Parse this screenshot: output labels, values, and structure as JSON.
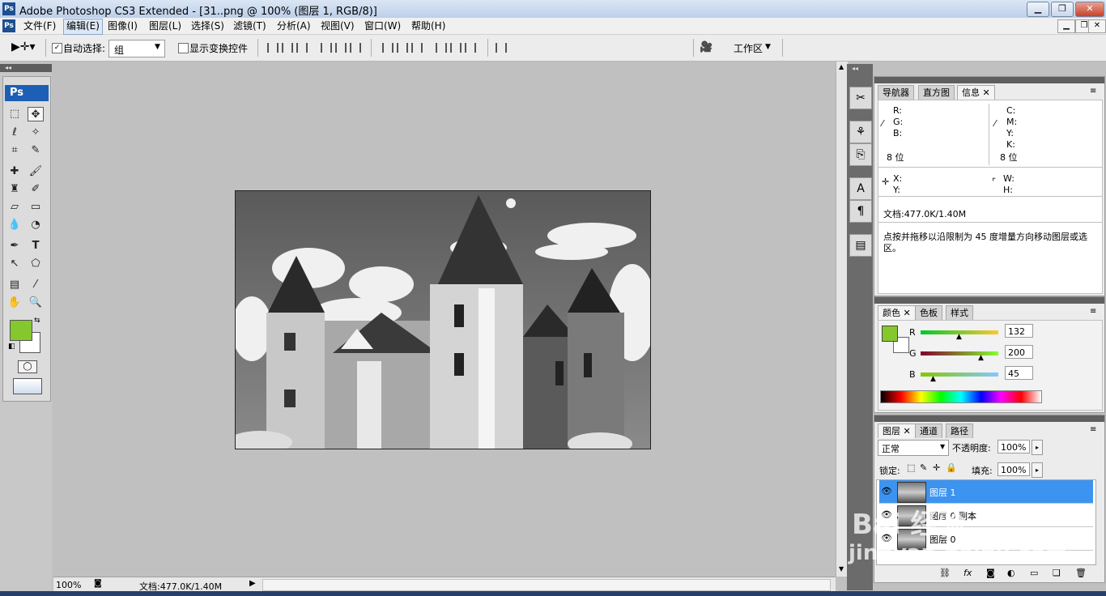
{
  "window": {
    "title": "Adobe Photoshop CS3 Extended - [31..png @ 100% (图层 1, RGB/8)]",
    "app_icon": "Ps",
    "controls": [
      "minimize-icon",
      "restore-icon",
      "close-icon"
    ]
  },
  "menu": {
    "items": [
      "文件(F)",
      "编辑(E)",
      "图像(I)",
      "图层(L)",
      "选择(S)",
      "滤镜(T)",
      "分析(A)",
      "视图(V)",
      "窗口(W)",
      "帮助(H)"
    ],
    "active": "编辑(E)",
    "doc_controls": [
      "minimize-icon",
      "restore-icon",
      "close-icon"
    ]
  },
  "options": {
    "auto_select_label": "自动选择:",
    "auto_select_checked": true,
    "auto_select_value": "组",
    "show_transform_label": "显示变换控件",
    "show_transform_checked": false,
    "workspace_label": "工作区"
  },
  "tools": {
    "logo": "Ps",
    "foreground_color": "#84c82d",
    "background_color": "#ffffff",
    "selected_tool": "move-tool"
  },
  "document": {
    "zoom": "100%",
    "doc_info": "文档:477.0K/1.40M"
  },
  "info_panel": {
    "tabs": [
      "导航器",
      "直方图",
      "信息"
    ],
    "active_tab": "信息",
    "left_channels": [
      "R:",
      "G:",
      "B:"
    ],
    "right_channels": [
      "C:",
      "M:",
      "Y:",
      "K:"
    ],
    "left_bits": "8 位",
    "right_bits": "8 位",
    "xy": [
      "X:",
      "Y:"
    ],
    "wh": [
      "W:",
      "H:"
    ],
    "doc_info": "文档:477.0K/1.40M",
    "hint": "点按并拖移以沿限制为 45 度增量方向移动图层或选区。"
  },
  "color_panel": {
    "tabs": [
      "颜色",
      "色板",
      "样式"
    ],
    "active_tab": "颜色",
    "channels": [
      {
        "label": "R",
        "value": "132"
      },
      {
        "label": "G",
        "value": "200"
      },
      {
        "label": "B",
        "value": "45"
      }
    ],
    "swatch": "#84c82d"
  },
  "layers_panel": {
    "tabs": [
      "图层",
      "通道",
      "路径"
    ],
    "active_tab": "图层",
    "blend_mode": "正常",
    "opacity_label": "不透明度:",
    "opacity": "100%",
    "lock_label": "锁定:",
    "fill_label": "填充:",
    "fill": "100%",
    "layers": [
      {
        "name": "图层 1",
        "selected": true
      },
      {
        "name": "图层 0 副本",
        "selected": false
      },
      {
        "name": "图层 0",
        "selected": false
      }
    ],
    "bottom_icons": [
      "link-icon",
      "fx-icon",
      "mask-icon",
      "adjustment-icon",
      "folder-icon",
      "new-layer-icon",
      "trash-icon"
    ]
  },
  "watermark": {
    "line1": "Bai 经验",
    "line2": "jingyan.baidu.com"
  }
}
